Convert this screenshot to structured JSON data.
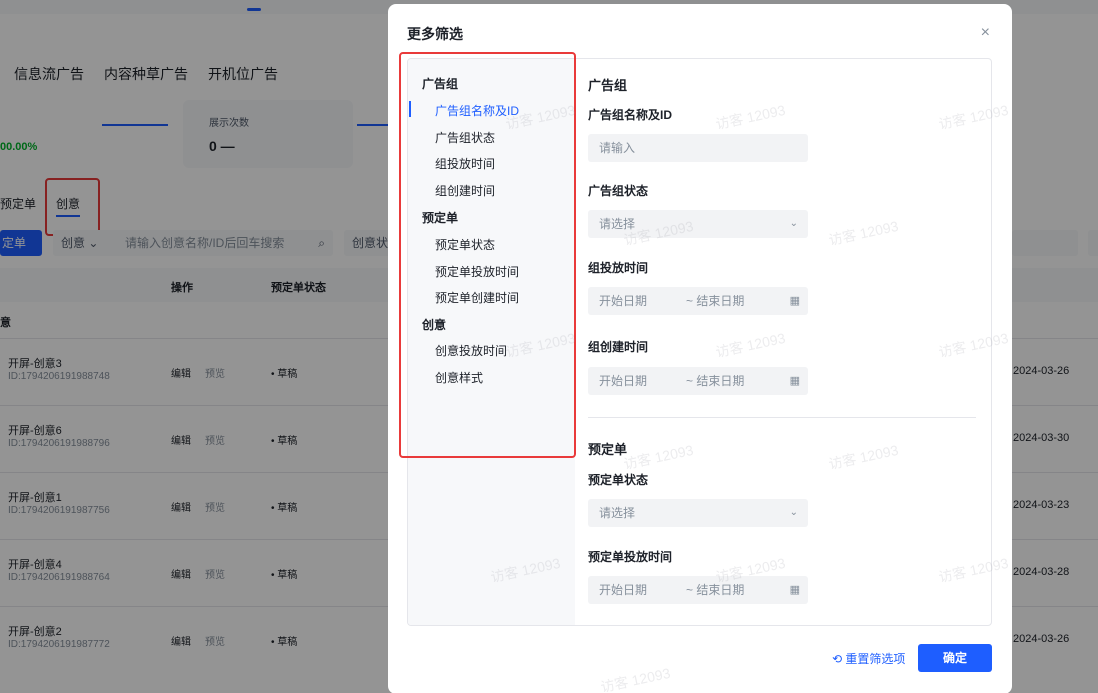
{
  "background": {
    "ad_tabs": [
      "信息流广告",
      "内容种草广告",
      "开机位广告"
    ],
    "metric_label": "展示次数",
    "metric_value": "0 —",
    "metric_percent": "00.00%",
    "sub_tabs": [
      "预定单",
      "创意"
    ],
    "create_button": "定单",
    "search_type": "创意 ⌄",
    "search_placeholder": "请输入创意名称/ID后回车搜索",
    "status_filter": "创意状",
    "table_headers": {
      "op": "操作",
      "status": "预定单状态"
    },
    "group_label": "意",
    "rows": [
      {
        "name": "开屏-创意3",
        "id": "ID:1794206191988748",
        "edit": "编辑",
        "preview": "预览",
        "status": "• 草稿",
        "date": "2024-03-26"
      },
      {
        "name": "开屏-创意6",
        "id": "ID:1794206191988796",
        "edit": "编辑",
        "preview": "预览",
        "status": "• 草稿",
        "date": "2024-03-30"
      },
      {
        "name": "开屏-创意1",
        "id": "ID:1794206191987756",
        "edit": "编辑",
        "preview": "预览",
        "status": "• 草稿",
        "date": "2024-03-23"
      },
      {
        "name": "开屏-创意4",
        "id": "ID:1794206191988764",
        "edit": "编辑",
        "preview": "预览",
        "status": "• 草稿",
        "date": "2024-03-28"
      },
      {
        "name": "开屏-创意2",
        "id": "ID:1794206191987772",
        "edit": "编辑",
        "preview": "预览",
        "status": "• 草稿",
        "date": "2024-03-26"
      }
    ]
  },
  "modal": {
    "title": "更多筛选",
    "close_icon": "×",
    "nav": {
      "groups": [
        "广告组",
        "预定单",
        "创意"
      ],
      "items": [
        "广告组名称及ID",
        "广告组状态",
        "组投放时间",
        "组创建时间",
        "预定单状态",
        "预定单投放时间",
        "预定单创建时间",
        "创意投放时间",
        "创意样式"
      ]
    },
    "sections": {
      "ad_group": {
        "title": "广告组",
        "name_label": "广告组名称及ID",
        "name_placeholder": "请输入",
        "status_label": "广告组状态",
        "status_placeholder": "请选择",
        "delivery_label": "组投放时间",
        "create_label": "组创建时间"
      },
      "order": {
        "title": "预定单",
        "status_label": "预定单状态",
        "status_placeholder": "请选择",
        "delivery_label": "预定单投放时间"
      }
    },
    "date_start": "开始日期",
    "date_end": "~ 结束日期",
    "reset_label": "⟲ 重置筛选项",
    "confirm_label": "确定"
  },
  "watermark": "访客 12093",
  "colors": {
    "primary": "#1e5eff",
    "highlight": "#e93a3a",
    "success": "#00b42a"
  }
}
